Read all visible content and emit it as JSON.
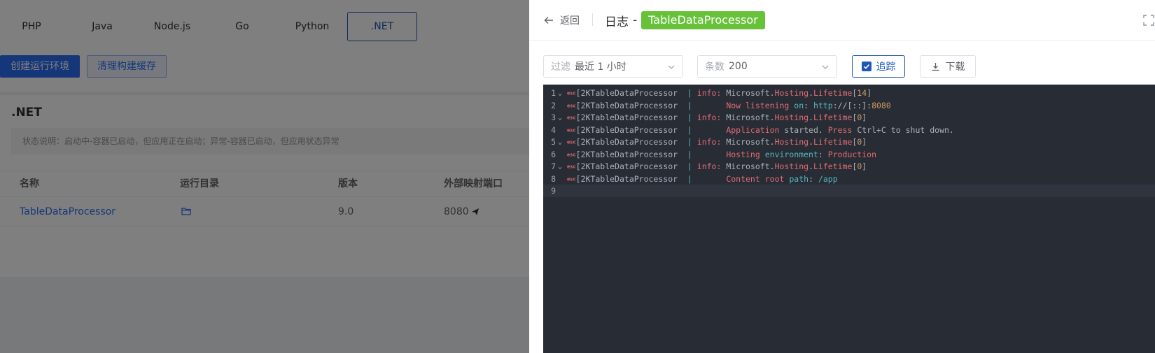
{
  "background": {
    "tabs": [
      "PHP",
      "Java",
      "Node.js",
      "Go",
      "Python",
      ".NET"
    ],
    "active_tab": ".NET",
    "create_button": "创建运行环境",
    "clear_cache_button": "清理构建缓存",
    "section_title": ".NET",
    "status_note": "状态说明：启动中-容器已启动，但应用正在启动；异常-容器已启动，但应用状态异常",
    "table": {
      "headers": [
        "名称",
        "运行目录",
        "版本",
        "外部映射端口"
      ],
      "rows": [
        {
          "name": "TableDataProcessor",
          "version": "9.0",
          "port": "8080"
        }
      ]
    }
  },
  "drawer": {
    "back_label": "返回",
    "title_prefix": "日志",
    "title_dash": "-",
    "app_name": "TableDataProcessor",
    "filter": {
      "label": "过滤",
      "value": "最近 1 小时"
    },
    "count": {
      "label": "条数",
      "value": "200"
    },
    "follow_label": "追踪",
    "follow_checked": true,
    "download_label": "下载"
  },
  "log": {
    "esc_token": "esc",
    "lines": [
      {
        "n": "1",
        "fold": true,
        "text": "[2KTableDataProcessor  | info: Microsoft.Hosting.Lifetime[14]"
      },
      {
        "n": "2",
        "fold": false,
        "text": "[2KTableDataProcessor  |       Now listening on: http://[::]:8080"
      },
      {
        "n": "3",
        "fold": true,
        "text": "[2KTableDataProcessor  | info: Microsoft.Hosting.Lifetime[0]"
      },
      {
        "n": "4",
        "fold": false,
        "text": "[2KTableDataProcessor  |       Application started. Press Ctrl+C to shut down."
      },
      {
        "n": "5",
        "fold": true,
        "text": "[2KTableDataProcessor  | info: Microsoft.Hosting.Lifetime[0]"
      },
      {
        "n": "6",
        "fold": false,
        "text": "[2KTableDataProcessor  |       Hosting environment: Production"
      },
      {
        "n": "7",
        "fold": true,
        "text": "[2KTableDataProcessor  | info: Microsoft.Hosting.Lifetime[0]"
      },
      {
        "n": "8",
        "fold": false,
        "text": "[2KTableDataProcessor  |       Content root path: /app"
      },
      {
        "n": "9",
        "fold": false,
        "text": ""
      }
    ]
  },
  "colors": {
    "accent": "#1f57b7",
    "tag_green": "#67c23a",
    "log_bg": "#282c34",
    "overlay": "rgba(0,0,0,0.5)"
  }
}
